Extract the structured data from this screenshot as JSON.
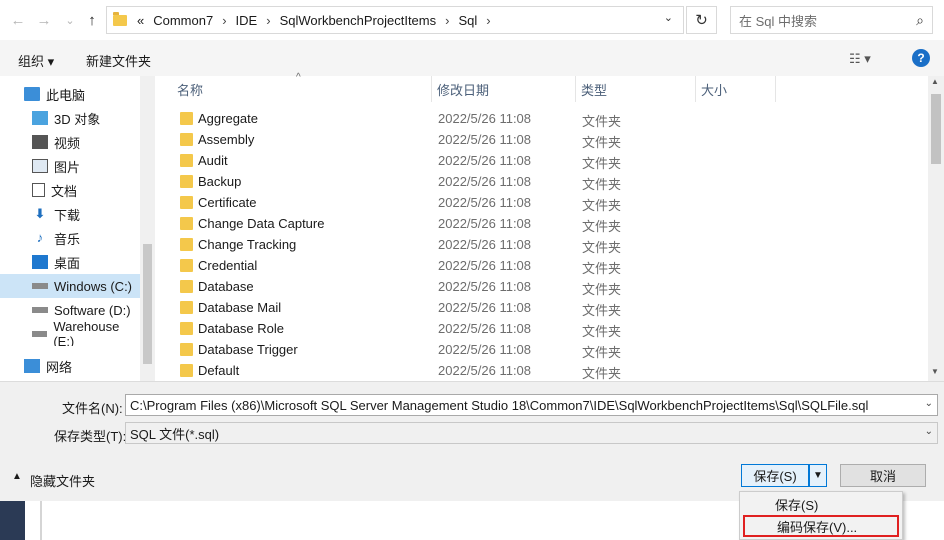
{
  "address": {
    "overflow": "«",
    "crumbs": [
      "Common7",
      "IDE",
      "SqlWorkbenchProjectItems",
      "Sql"
    ],
    "search_placeholder": "在 Sql 中搜索"
  },
  "toolbar": {
    "organize": "组织 ▾",
    "new_folder": "新建文件夹"
  },
  "nav": {
    "items": [
      {
        "label": "此电脑",
        "icon": "computer-icon"
      },
      {
        "label": "3D 对象",
        "icon": "cube-icon"
      },
      {
        "label": "视频",
        "icon": "video-icon"
      },
      {
        "label": "图片",
        "icon": "picture-icon"
      },
      {
        "label": "文档",
        "icon": "document-icon"
      },
      {
        "label": "下载",
        "icon": "download-icon"
      },
      {
        "label": "音乐",
        "icon": "music-icon"
      },
      {
        "label": "桌面",
        "icon": "desktop-icon"
      },
      {
        "label": "Windows (C:)",
        "icon": "drive-icon"
      },
      {
        "label": "Software (D:)",
        "icon": "drive-icon"
      },
      {
        "label": "Warehouse (E:)",
        "icon": "drive-icon"
      },
      {
        "label": "网络",
        "icon": "network-icon"
      }
    ]
  },
  "columns": {
    "name": "名称",
    "date": "修改日期",
    "type": "类型",
    "size": "大小"
  },
  "files": [
    {
      "name": "Aggregate",
      "date": "2022/5/26 11:08",
      "type": "文件夹"
    },
    {
      "name": "Assembly",
      "date": "2022/5/26 11:08",
      "type": "文件夹"
    },
    {
      "name": "Audit",
      "date": "2022/5/26 11:08",
      "type": "文件夹"
    },
    {
      "name": "Backup",
      "date": "2022/5/26 11:08",
      "type": "文件夹"
    },
    {
      "name": "Certificate",
      "date": "2022/5/26 11:08",
      "type": "文件夹"
    },
    {
      "name": "Change Data Capture",
      "date": "2022/5/26 11:08",
      "type": "文件夹"
    },
    {
      "name": "Change Tracking",
      "date": "2022/5/26 11:08",
      "type": "文件夹"
    },
    {
      "name": "Credential",
      "date": "2022/5/26 11:08",
      "type": "文件夹"
    },
    {
      "name": "Database",
      "date": "2022/5/26 11:08",
      "type": "文件夹"
    },
    {
      "name": "Database Mail",
      "date": "2022/5/26 11:08",
      "type": "文件夹"
    },
    {
      "name": "Database Role",
      "date": "2022/5/26 11:08",
      "type": "文件夹"
    },
    {
      "name": "Database Trigger",
      "date": "2022/5/26 11:08",
      "type": "文件夹"
    },
    {
      "name": "Default",
      "date": "2022/5/26 11:08",
      "type": "文件夹"
    }
  ],
  "form": {
    "filename_label": "文件名(N):",
    "filename_value": "C:\\Program Files (x86)\\Microsoft SQL Server Management Studio 18\\Common7\\IDE\\SqlWorkbenchProjectItems\\Sql\\SQLFile.sql",
    "filetype_label": "保存类型(T):",
    "filetype_value": "SQL 文件(*.sql)"
  },
  "footer": {
    "hide_folders": "隐藏文件夹",
    "save": "保存(S)",
    "cancel": "取消"
  },
  "save_menu": {
    "items": [
      "保存(S)",
      "编码保存(V)..."
    ]
  },
  "colors": {
    "accent": "#0078d7",
    "highlight_box": "#e02020",
    "folder": "#f4c84b"
  }
}
